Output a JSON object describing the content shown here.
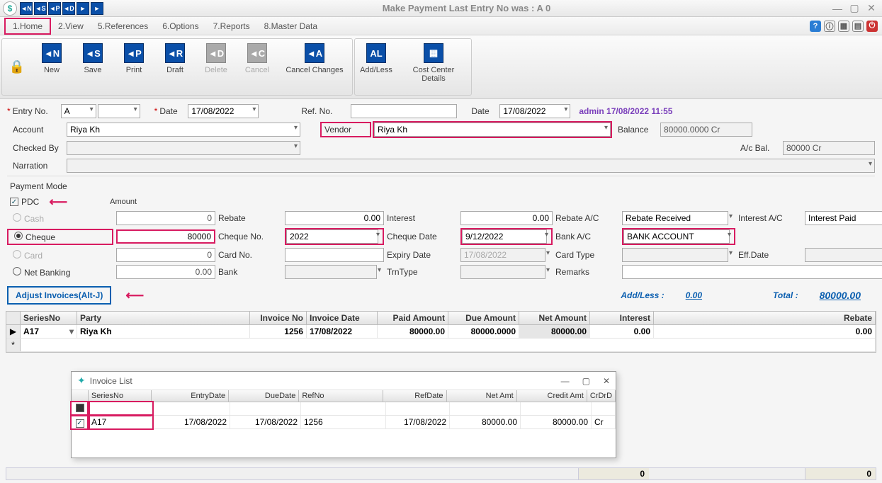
{
  "title": "Make Payment    Last Entry No was : A 0",
  "qa": [
    "◄N",
    "◄S",
    "◄P",
    "◄D",
    "►",
    "►"
  ],
  "menus": [
    "1.Home",
    "2.View",
    "5.References",
    "6.Options",
    "7.Reports",
    "8.Master Data"
  ],
  "ribbon": {
    "g1": [
      {
        "ico": "◄N",
        "lbl": "New"
      },
      {
        "ico": "◄S",
        "lbl": "Save"
      },
      {
        "ico": "◄P",
        "lbl": "Print"
      },
      {
        "ico": "◄R",
        "lbl": "Draft"
      },
      {
        "ico": "◄D",
        "lbl": "Delete",
        "dis": true
      },
      {
        "ico": "◄C",
        "lbl": "Cancel",
        "dis": true
      },
      {
        "ico": "◄A",
        "lbl": "Cancel Changes"
      }
    ],
    "g2": [
      {
        "ico": "AL",
        "lbl": "Add/Less"
      },
      {
        "ico": "▦",
        "lbl": "Cost Center Details"
      }
    ]
  },
  "form": {
    "entry_no_lbl": "Entry No.",
    "entry_series": "A",
    "date_lbl": "Date",
    "date": "17/08/2022",
    "refno_lbl": "Ref. No.",
    "refno": "",
    "date2_lbl": "Date",
    "date2": "17/08/2022",
    "audit": "admin 17/08/2022 11:55",
    "account_lbl": "Account",
    "account": "Riya Kh",
    "vendor_lbl": "Vendor",
    "vendor": "Riya Kh",
    "balance_lbl": "Balance",
    "balance": "80000.0000 Cr",
    "checked_lbl": "Checked By",
    "acbal_lbl": "A/c Bal.",
    "acbal": "80000 Cr",
    "narr_lbl": "Narration"
  },
  "pm": {
    "title": "Payment Mode",
    "pdc": "PDC",
    "amount_hdr": "Amount",
    "cash": "Cash",
    "cheque": "Cheque",
    "card": "Card",
    "netb": "Net Banking",
    "cash_amt": "0",
    "cheque_amt": "80000",
    "card_amt": "0",
    "net_amt": "0.00",
    "rebate_lbl": "Rebate",
    "rebate": "0.00",
    "interest_lbl": "Interest",
    "interest": "0.00",
    "rebate_ac_lbl": "Rebate A/C",
    "rebate_ac": "Rebate Received",
    "interest_ac_lbl": "Interest A/C",
    "interest_ac": "Interest Paid",
    "cheque_no_lbl": "Cheque No.",
    "cheque_no": "2022",
    "cheque_date_lbl": "Cheque Date",
    "cheque_date": "9/12/2022",
    "bank_ac_lbl": "Bank A/C",
    "bank_ac": "BANK ACCOUNT",
    "card_no_lbl": "Card No.",
    "expiry_lbl": "Expiry Date",
    "expiry": "17/08/2022",
    "card_type_lbl": "Card Type",
    "effdate_lbl": "Eff.Date",
    "bank_lbl": "Bank",
    "trn_lbl": "TrnType",
    "remarks_lbl": "Remarks"
  },
  "adjust": "Adjust Invoices(Alt-J)",
  "addless_lbl": "Add/Less :",
  "addless": "0.00",
  "total_lbl": "Total :",
  "total": "80000.00",
  "grid": {
    "cols": [
      "SeriesNo",
      "Party",
      "Invoice No",
      "Invoice Date",
      "Paid Amount",
      "Due Amount",
      "Net Amount",
      "Interest",
      "Rebate"
    ],
    "row": {
      "series": "A17",
      "party": "Riya Kh",
      "invno": "1256",
      "invdate": "17/08/2022",
      "paid": "80000.00",
      "due": "80000.0000",
      "net": "80000.00",
      "interest": "0.00",
      "rebate": "0.00"
    }
  },
  "dialog": {
    "title": "Invoice List",
    "cols": [
      "SeriesNo",
      "EntryDate",
      "DueDate",
      "RefNo",
      "RefDate",
      "Net Amt",
      "Credit Amt",
      "CrDrD"
    ],
    "row": {
      "chk": true,
      "series": "A17",
      "edate": "17/08/2022",
      "ddate": "17/08/2022",
      "ref": "1256",
      "rdate": "17/08/2022",
      "net": "80000.00",
      "credit": "80000.00",
      "crd": "Cr"
    }
  },
  "footer": {
    "v1": "0",
    "v2": "0"
  }
}
